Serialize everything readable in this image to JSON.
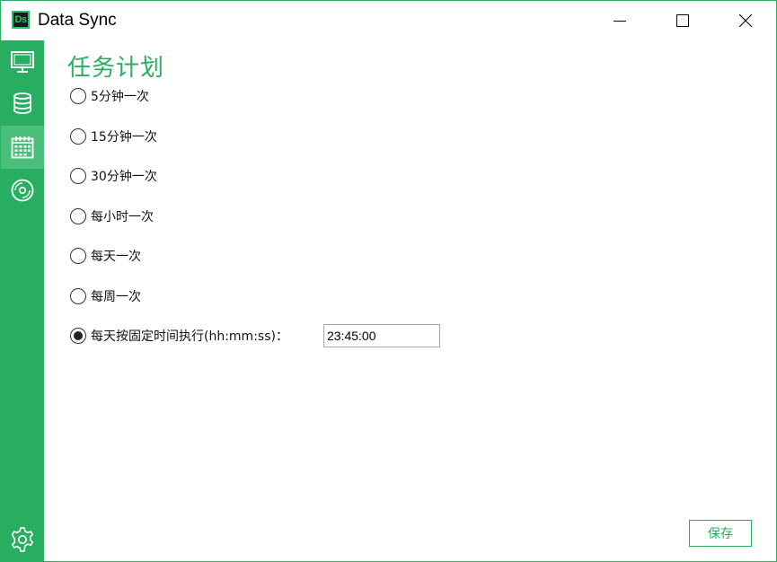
{
  "window": {
    "title": "Data Sync",
    "logo_text": "Ds"
  },
  "colors": {
    "accent": "#27ae60",
    "accent_active": "#4cbe7c"
  },
  "sidebar": {
    "items": [
      {
        "icon": "monitor-icon",
        "active": false
      },
      {
        "icon": "database-icon",
        "active": false
      },
      {
        "icon": "calendar-icon",
        "active": true
      },
      {
        "icon": "disc-icon",
        "active": false
      }
    ],
    "footer_icon": "gear-icon"
  },
  "schedule": {
    "title": "任务计划",
    "options": [
      {
        "label": "5分钟一次",
        "selected": false
      },
      {
        "label": "15分钟一次",
        "selected": false
      },
      {
        "label": "30分钟一次",
        "selected": false
      },
      {
        "label": "每小时一次",
        "selected": false
      },
      {
        "label": "每天一次",
        "selected": false
      },
      {
        "label": "每周一次",
        "selected": false
      },
      {
        "label": "每天按固定时间执行(hh:mm:ss)：",
        "selected": true
      }
    ],
    "time_value": "23:45:00"
  },
  "actions": {
    "save_label": "保存"
  }
}
